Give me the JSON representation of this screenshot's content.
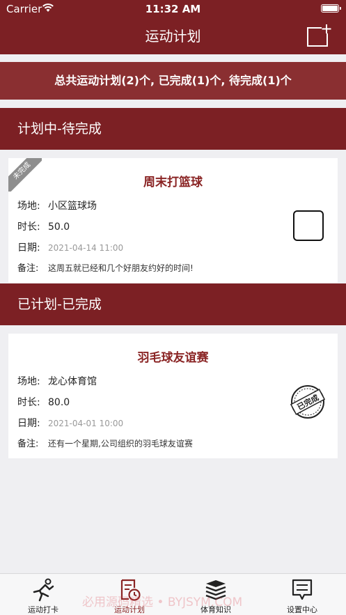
{
  "status_bar": {
    "carrier": "Carrier",
    "time": "11:32 AM"
  },
  "nav": {
    "title": "运动计划",
    "add_icon": "add-square-icon"
  },
  "summary": "总共运动计划(2)个, 已完成(1)个, 待完成(1)个",
  "sections": {
    "pending": {
      "title": "计划中-待完成"
    },
    "done": {
      "title": "已计划-已完成"
    }
  },
  "cards": [
    {
      "title": "周末打篮球",
      "badge": "未完成",
      "venue_label": "场地:",
      "venue": "小区篮球场",
      "duration_label": "时长:",
      "duration": "50.0",
      "date_label": "日期:",
      "date": "2021-04-14 11:00",
      "note_label": "备注:",
      "note": "这周五就已经和几个好朋友约好的时间!",
      "status": "unchecked"
    },
    {
      "title": "羽毛球友谊赛",
      "venue_label": "场地:",
      "venue": "龙心体育馆",
      "duration_label": "时长:",
      "duration": "80.0",
      "date_label": "日期:",
      "date": "2021-04-01 10:00",
      "note_label": "备注:",
      "note": "还有一个星期,公司组织的羽毛球友谊赛",
      "stamp": "已完成",
      "status": "completed"
    }
  ],
  "tabs": [
    {
      "label": "运动打卡",
      "icon": "athlete-icon",
      "active": false
    },
    {
      "label": "运动计划",
      "icon": "plan-clock-icon",
      "active": true
    },
    {
      "label": "体育知识",
      "icon": "books-icon",
      "active": false
    },
    {
      "label": "设置中心",
      "icon": "message-icon",
      "active": false
    }
  ],
  "watermark": "必用源码精选 • BYJSYM.COM",
  "colors": {
    "primary": "#7c2024",
    "summary_bg": "#8a2f31",
    "title_red": "#8a2424",
    "background": "#efeff2"
  }
}
